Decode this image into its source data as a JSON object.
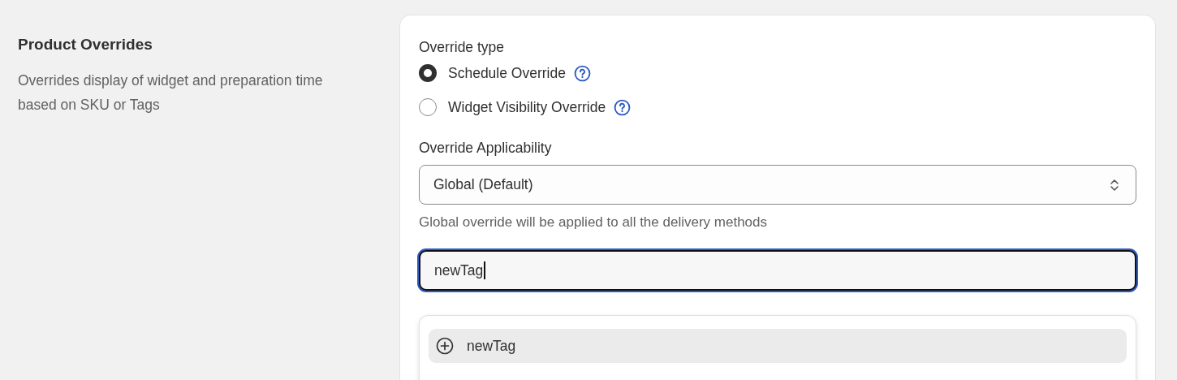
{
  "section": {
    "title": "Product Overrides",
    "description": "Overrides display of widget and preparation time based on SKU or Tags"
  },
  "override_type": {
    "label": "Override type",
    "options": [
      {
        "label": "Schedule Override",
        "selected": true
      },
      {
        "label": "Widget Visibility Override",
        "selected": false
      }
    ]
  },
  "applicability": {
    "label": "Override Applicability",
    "value": "Global (Default)",
    "help_text": "Global override will be applied to all the delivery methods"
  },
  "tag_field": {
    "value": "newTag",
    "focused": true
  },
  "suggestions": [
    {
      "label": "newTag",
      "selected": true
    }
  ]
}
